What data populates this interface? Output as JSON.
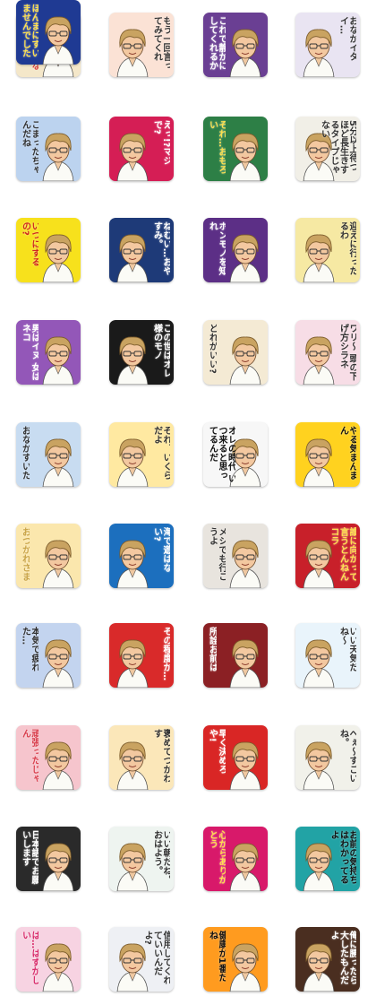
{
  "stickers": [
    {
      "caption": "くるしゅ〜ないぞよ",
      "bg": "#f4e7c9",
      "accent": "#d9403a"
    },
    {
      "caption": "もう一回言ってみてくれ",
      "bg": "#fbe2d5",
      "accent": "#333333"
    },
    {
      "caption": "これで静かにしてくれるか",
      "bg": "#6a3f93",
      "accent": "#ffffff"
    },
    {
      "caption": "おなかイタイ…",
      "bg": "#e9e4f2",
      "accent": "#333333"
    },
    {
      "caption": "こまったちゃんだね",
      "bg": "#bcd3ef",
      "accent": "#333333"
    },
    {
      "caption": "えっ!?マジで?",
      "bg": "#d51e55",
      "accent": "#ffffff"
    },
    {
      "caption": "それ…おもろい",
      "bg": "#2d7f46",
      "accent": "#ffe14d"
    },
    {
      "caption": "5分以上待つほど長生きするタイプじゃない",
      "bg": "#f1efe7",
      "accent": "#333333"
    },
    {
      "caption": "いつにするの?",
      "bg": "#f7e11c",
      "accent": "#d0281d"
    },
    {
      "caption": "ねむい…おやすみ。",
      "bg": "#1e3a78",
      "accent": "#ffffff"
    },
    {
      "caption": "ホンモノを知れ",
      "bg": "#5c2f86",
      "accent": "#ffffff"
    },
    {
      "caption": "迎えに行ったるわ",
      "bg": "#f6e9a3",
      "accent": "#333333"
    },
    {
      "caption": "男はイヌ 女はネコ",
      "bg": "#9357b8",
      "accent": "#ffffff"
    },
    {
      "caption": "この世はオレ様のモノ",
      "bg": "#1a1a1a",
      "accent": "#ffffff"
    },
    {
      "caption": "どれがいい?",
      "bg": "#f4ead4",
      "accent": "#333333"
    },
    {
      "caption": "ワリ〜 頭の下げ方シラネ",
      "bg": "#f7dde6",
      "accent": "#333333"
    },
    {
      "caption": "おなかすいた",
      "bg": "#c8dcf1",
      "accent": "#333333"
    },
    {
      "caption": "それ、いくらだよ",
      "bg": "#ffe9a1",
      "accent": "#333333"
    },
    {
      "caption": "オレの時代 いつ来ると思ってるんだ",
      "bg": "#f7f7f7",
      "accent": "#111111"
    },
    {
      "caption": "やる気まんまん",
      "bg": "#ffd21f",
      "accent": "#111111"
    },
    {
      "caption": "おつかれさま",
      "bg": "#fbe7ad",
      "accent": "#c9a447"
    },
    {
      "caption": "海で遊ばない?",
      "bg": "#1c6fbe",
      "accent": "#ffffff"
    },
    {
      "caption": "メシでも行こうよ",
      "bg": "#e8e4de",
      "accent": "#333333"
    },
    {
      "caption": "誰に向かって言うとんねん コラ",
      "bg": "#c8202a",
      "accent": "#ffe14d"
    },
    {
      "caption": "本気で疲れた…",
      "bg": "#c3d4ef",
      "accent": "#333333"
    },
    {
      "caption": "その程度か…",
      "bg": "#d92a2a",
      "accent": "#ffffff"
    },
    {
      "caption": "所詮お前は",
      "bg": "#8b2024",
      "accent": "#ffffff"
    },
    {
      "caption": "いい天気だね〜",
      "bg": "#e9f4fb",
      "accent": "#333333"
    },
    {
      "caption": "頑張ったじゃん",
      "bg": "#f6c5cd",
      "accent": "#d9404e"
    },
    {
      "caption": "褒めてつかわす",
      "bg": "#fbe7b9",
      "accent": "#333333"
    },
    {
      "caption": "早く決めろや!",
      "bg": "#d92625",
      "accent": "#ffffff"
    },
    {
      "caption": "へぇ〜すごいね。",
      "bg": "#f1f1ea",
      "accent": "#333333"
    },
    {
      "caption": "日本語でお願いします",
      "bg": "#2a2a2a",
      "accent": "#ffffff"
    },
    {
      "caption": "いい朝だね。おはよう。",
      "bg": "#eef4f0",
      "accent": "#333333"
    },
    {
      "caption": "心からありがとう",
      "bg": "#d8196a",
      "accent": "#ffe14d"
    },
    {
      "caption": "お前の気持ちはわかってるよ",
      "bg": "#22a3a5",
      "accent": "#111111"
    },
    {
      "caption": "は…はずかしい",
      "bg": "#f7d3e2",
      "accent": "#d82c6b"
    },
    {
      "caption": "信用してくれていいんだよ?",
      "bg": "#eef0f4",
      "accent": "#333333"
    },
    {
      "caption": "健康が1番だね",
      "bg": "#ff9b1f",
      "accent": "#111111"
    },
    {
      "caption": "俺に勝ったら大したもんだよ",
      "bg": "#4a2e20",
      "accent": "#ffffff"
    },
    {
      "caption": "ほんまにすいませんでした",
      "bg": "#1f3a93",
      "accent": "#ffe14d"
    }
  ]
}
